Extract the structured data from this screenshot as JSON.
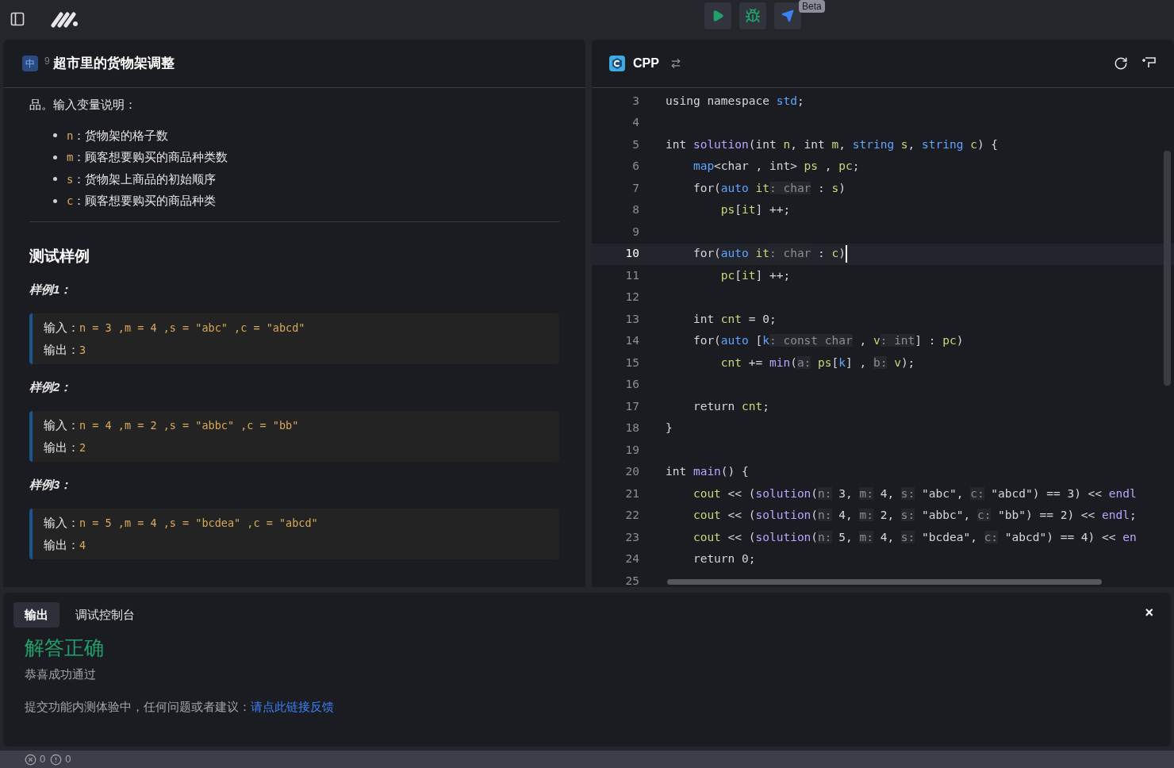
{
  "toolbar": {
    "badge": "Beta"
  },
  "problem": {
    "difficulty": "中",
    "number": "9",
    "title": "超市里的货物架调整",
    "intro": "品。输入变量说明：",
    "variables": [
      {
        "name": "n",
        "desc": "：货物架的格子数"
      },
      {
        "name": "m",
        "desc": "：顾客想要购买的商品种类数"
      },
      {
        "name": "s",
        "desc": "：货物架上商品的初始顺序"
      },
      {
        "name": "c",
        "desc": "：顾客想要购买的商品种类"
      }
    ],
    "section_title": "测试样例",
    "samples": [
      {
        "title": "样例1：",
        "input_label": "输入：",
        "input": "n = 3 ,m = 4 ,s = \"abc\" ,c = \"abcd\"",
        "output_label": "输出：",
        "output": "3"
      },
      {
        "title": "样例2：",
        "input_label": "输入：",
        "input": "n = 4 ,m = 2 ,s = \"abbc\" ,c = \"bb\"",
        "output_label": "输出：",
        "output": "2"
      },
      {
        "title": "样例3：",
        "input_label": "输入：",
        "input": "n = 5 ,m = 4 ,s = \"bcdea\" ,c = \"abcd\"",
        "output_label": "输出：",
        "output": "4"
      }
    ]
  },
  "editor": {
    "language": "CPP",
    "lines": [
      {
        "number": "3",
        "current": false,
        "tokens": [
          {
            "kind": "plain",
            "text": "using namespace "
          },
          {
            "kind": "type",
            "text": "std"
          },
          {
            "kind": "plain",
            "text": ";"
          }
        ]
      },
      {
        "number": "4",
        "current": false
      },
      {
        "number": "5",
        "current": false,
        "tokens": [
          {
            "kind": "plain",
            "text": "int "
          },
          {
            "kind": "fn",
            "text": "solution"
          },
          {
            "kind": "plain",
            "text": "(int "
          },
          {
            "kind": "var",
            "text": "n"
          },
          {
            "kind": "plain",
            "text": ", int "
          },
          {
            "kind": "var",
            "text": "m"
          },
          {
            "kind": "plain",
            "text": ", "
          },
          {
            "kind": "type",
            "text": "string "
          },
          {
            "kind": "var",
            "text": "s"
          },
          {
            "kind": "plain",
            "text": ", "
          },
          {
            "kind": "type",
            "text": "string "
          },
          {
            "kind": "var",
            "text": "c"
          },
          {
            "kind": "plain",
            "text": ") {"
          }
        ]
      },
      {
        "number": "6",
        "current": false,
        "tokens": [
          {
            "kind": "type",
            "text": "    map"
          },
          {
            "kind": "plain",
            "text": "<char , int> "
          },
          {
            "kind": "var",
            "text": "ps"
          },
          {
            "kind": "plain",
            "text": " , "
          },
          {
            "kind": "var",
            "text": "pc"
          },
          {
            "kind": "plain",
            "text": ";"
          }
        ]
      },
      {
        "number": "7",
        "current": false,
        "tokens": [
          {
            "kind": "plain",
            "text": "    for("
          },
          {
            "kind": "type",
            "text": "auto "
          },
          {
            "kind": "var",
            "text": "it"
          },
          {
            "kind": "hint",
            "text": ": char"
          },
          {
            "kind": "plain",
            "text": " : "
          },
          {
            "kind": "var",
            "text": "s"
          },
          {
            "kind": "plain",
            "text": ")"
          }
        ]
      },
      {
        "number": "8",
        "current": false,
        "tokens": [
          {
            "kind": "var",
            "text": "        ps"
          },
          {
            "kind": "plain",
            "text": "["
          },
          {
            "kind": "var",
            "text": "it"
          },
          {
            "kind": "plain",
            "text": "] ++;"
          }
        ]
      },
      {
        "number": "9",
        "current": false
      },
      {
        "number": "10",
        "current": true,
        "tokens": [
          {
            "kind": "plain",
            "text": "    for("
          },
          {
            "kind": "type",
            "text": "auto "
          },
          {
            "kind": "var",
            "text": "it"
          },
          {
            "kind": "hint",
            "text": ": char"
          },
          {
            "kind": "plain",
            "text": " : "
          },
          {
            "kind": "var",
            "text": "c"
          },
          {
            "kind": "plain",
            "text": ")"
          }
        ]
      },
      {
        "number": "11",
        "current": false,
        "tokens": [
          {
            "kind": "var",
            "text": "        pc"
          },
          {
            "kind": "plain",
            "text": "["
          },
          {
            "kind": "var",
            "text": "it"
          },
          {
            "kind": "plain",
            "text": "] ++;"
          }
        ]
      },
      {
        "number": "12",
        "current": false
      },
      {
        "number": "13",
        "current": false,
        "tokens": [
          {
            "kind": "plain",
            "text": "    int "
          },
          {
            "kind": "var",
            "text": "cnt"
          },
          {
            "kind": "plain",
            "text": " = 0;"
          }
        ]
      },
      {
        "number": "14",
        "current": false,
        "tokens": [
          {
            "kind": "plain",
            "text": "    for("
          },
          {
            "kind": "type",
            "text": "auto "
          },
          {
            "kind": "plain",
            "text": "["
          },
          {
            "kind": "type",
            "text": "k"
          },
          {
            "kind": "hint",
            "text": ": const char"
          },
          {
            "kind": "plain",
            "text": " , "
          },
          {
            "kind": "var",
            "text": "v"
          },
          {
            "kind": "hint",
            "text": ": int"
          },
          {
            "kind": "plain",
            "text": "] : "
          },
          {
            "kind": "var",
            "text": "pc"
          },
          {
            "kind": "plain",
            "text": ")"
          }
        ]
      },
      {
        "number": "15",
        "current": false,
        "tokens": [
          {
            "kind": "var",
            "text": "        cnt"
          },
          {
            "kind": "plain",
            "text": " += "
          },
          {
            "kind": "fn",
            "text": "min"
          },
          {
            "kind": "plain",
            "text": "("
          },
          {
            "kind": "hint",
            "text": "a:"
          },
          {
            "kind": "var",
            "text": " ps"
          },
          {
            "kind": "plain",
            "text": "["
          },
          {
            "kind": "type",
            "text": "k"
          },
          {
            "kind": "plain",
            "text": "] , "
          },
          {
            "kind": "hint",
            "text": "b:"
          },
          {
            "kind": "var",
            "text": " v"
          },
          {
            "kind": "plain",
            "text": ");"
          }
        ]
      },
      {
        "number": "16",
        "current": false
      },
      {
        "number": "17",
        "current": false,
        "tokens": [
          {
            "kind": "plain",
            "text": "    return "
          },
          {
            "kind": "var",
            "text": "cnt"
          },
          {
            "kind": "plain",
            "text": ";"
          }
        ]
      },
      {
        "number": "18",
        "current": false,
        "tokens": [
          {
            "kind": "plain",
            "text": "}"
          }
        ]
      },
      {
        "number": "19",
        "current": false
      },
      {
        "number": "20",
        "current": false,
        "tokens": [
          {
            "kind": "plain",
            "text": "int "
          },
          {
            "kind": "fn",
            "text": "main"
          },
          {
            "kind": "plain",
            "text": "() {"
          }
        ]
      },
      {
        "number": "21",
        "current": false,
        "tokens": [
          {
            "kind": "var",
            "text": "    cout"
          },
          {
            "kind": "plain",
            "text": " << ("
          },
          {
            "kind": "fn",
            "text": "solution"
          },
          {
            "kind": "plain",
            "text": "("
          },
          {
            "kind": "hint",
            "text": "n:"
          },
          {
            "kind": "plain",
            "text": " 3, "
          },
          {
            "kind": "hint",
            "text": "m:"
          },
          {
            "kind": "plain",
            "text": " 4, "
          },
          {
            "kind": "hint",
            "text": "s:"
          },
          {
            "kind": "plain",
            "text": " \"abc\", "
          },
          {
            "kind": "hint",
            "text": "c:"
          },
          {
            "kind": "plain",
            "text": " \"abcd\") == 3) << "
          },
          {
            "kind": "fn",
            "text": "endl"
          }
        ]
      },
      {
        "number": "22",
        "current": false,
        "tokens": [
          {
            "kind": "var",
            "text": "    cout"
          },
          {
            "kind": "plain",
            "text": " << ("
          },
          {
            "kind": "fn",
            "text": "solution"
          },
          {
            "kind": "plain",
            "text": "("
          },
          {
            "kind": "hint",
            "text": "n:"
          },
          {
            "kind": "plain",
            "text": " 4, "
          },
          {
            "kind": "hint",
            "text": "m:"
          },
          {
            "kind": "plain",
            "text": " 2, "
          },
          {
            "kind": "hint",
            "text": "s:"
          },
          {
            "kind": "plain",
            "text": " \"abbc\", "
          },
          {
            "kind": "hint",
            "text": "c:"
          },
          {
            "kind": "plain",
            "text": " \"bb\") == 2) << "
          },
          {
            "kind": "fn",
            "text": "endl"
          },
          {
            "kind": "plain",
            "text": ";"
          }
        ]
      },
      {
        "number": "23",
        "current": false,
        "tokens": [
          {
            "kind": "var",
            "text": "    cout"
          },
          {
            "kind": "plain",
            "text": " << ("
          },
          {
            "kind": "fn",
            "text": "solution"
          },
          {
            "kind": "plain",
            "text": "("
          },
          {
            "kind": "hint",
            "text": "n:"
          },
          {
            "kind": "plain",
            "text": " 5, "
          },
          {
            "kind": "hint",
            "text": "m:"
          },
          {
            "kind": "plain",
            "text": " 4, "
          },
          {
            "kind": "hint",
            "text": "s:"
          },
          {
            "kind": "plain",
            "text": " \"bcdea\", "
          },
          {
            "kind": "hint",
            "text": "c:"
          },
          {
            "kind": "plain",
            "text": " \"abcd\") == 4) << "
          },
          {
            "kind": "fn",
            "text": "en"
          }
        ]
      },
      {
        "number": "24",
        "current": false,
        "tokens": [
          {
            "kind": "plain",
            "text": "    return 0;"
          }
        ]
      },
      {
        "number": "25",
        "current": false
      }
    ]
  },
  "output": {
    "tabs": [
      {
        "label": "输出",
        "selected": true
      },
      {
        "label": "调试控制台",
        "selected": false
      }
    ],
    "close": "×",
    "result": "解答正确",
    "message": "恭喜成功通过",
    "feedback": "提交功能内测体验中，任何问题或者建议：",
    "link": "请点此链接反馈"
  },
  "status_bar": {
    "errors": "0",
    "warnings": "0"
  }
}
